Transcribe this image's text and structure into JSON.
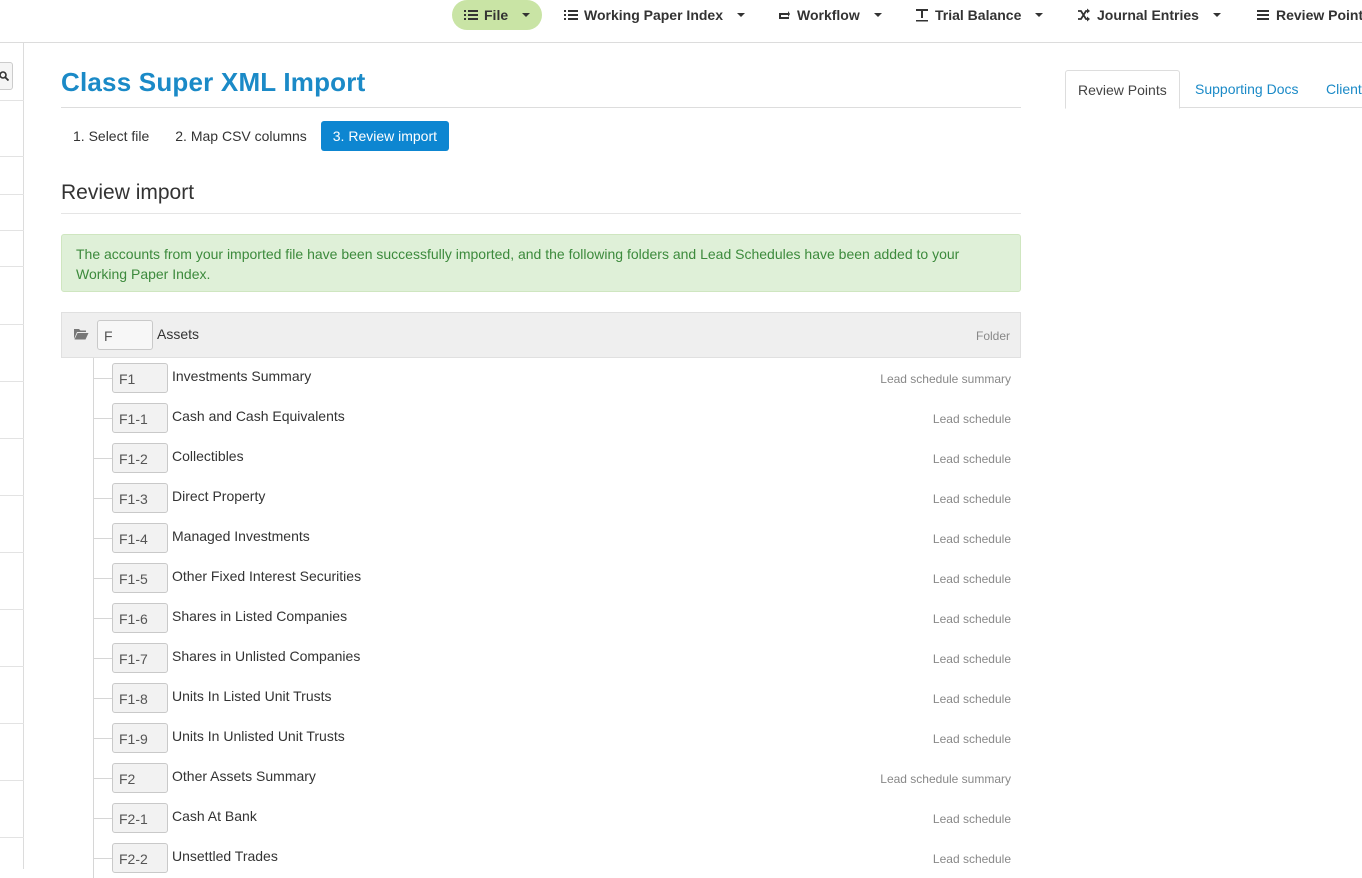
{
  "nav": {
    "items": [
      {
        "label": "File",
        "icon": "list-icon",
        "active": true
      },
      {
        "label": "Working Paper Index",
        "icon": "list-icon",
        "active": false
      },
      {
        "label": "Workflow",
        "icon": "loop-icon",
        "active": false
      },
      {
        "label": "Trial Balance",
        "icon": "text-format-icon",
        "active": false
      },
      {
        "label": "Journal Entries",
        "icon": "shuffle-icon",
        "active": false
      },
      {
        "label": "Review Point",
        "icon": "list-icon",
        "active": false
      }
    ]
  },
  "page": {
    "title": "Class Super XML Import",
    "steps": [
      {
        "label": "1. Select file",
        "active": false
      },
      {
        "label": "2. Map CSV columns",
        "active": false
      },
      {
        "label": "3. Review import",
        "active": true
      }
    ],
    "section_title": "Review import",
    "alert": "The accounts from your imported file have been successfully imported, and the following folders and Lead Schedules have been added to your Working Paper Index."
  },
  "folder": {
    "code": "F",
    "name": "Assets",
    "type": "Folder"
  },
  "rows": [
    {
      "code": "F1",
      "name": "Investments Summary",
      "type": "Lead schedule summary"
    },
    {
      "code": "F1-1",
      "name": "Cash and Cash Equivalents",
      "type": "Lead schedule"
    },
    {
      "code": "F1-2",
      "name": "Collectibles",
      "type": "Lead schedule"
    },
    {
      "code": "F1-3",
      "name": "Direct Property",
      "type": "Lead schedule"
    },
    {
      "code": "F1-4",
      "name": "Managed Investments",
      "type": "Lead schedule"
    },
    {
      "code": "F1-5",
      "name": "Other Fixed Interest Securities",
      "type": "Lead schedule"
    },
    {
      "code": "F1-6",
      "name": "Shares in Listed Companies",
      "type": "Lead schedule"
    },
    {
      "code": "F1-7",
      "name": "Shares in Unlisted Companies",
      "type": "Lead schedule"
    },
    {
      "code": "F1-8",
      "name": "Units In Listed Unit Trusts",
      "type": "Lead schedule"
    },
    {
      "code": "F1-9",
      "name": "Units In Unlisted Unit Trusts",
      "type": "Lead schedule"
    },
    {
      "code": "F2",
      "name": "Other Assets Summary",
      "type": "Lead schedule summary"
    },
    {
      "code": "F2-1",
      "name": "Cash At Bank",
      "type": "Lead schedule"
    },
    {
      "code": "F2-2",
      "name": "Unsettled Trades",
      "type": "Lead schedule"
    }
  ],
  "right_tabs": [
    {
      "label": "Review Points",
      "active": true
    },
    {
      "label": "Supporting Docs",
      "active": false
    },
    {
      "label": "Client",
      "active": false
    }
  ],
  "colors": {
    "accent": "#1b8ac7",
    "step_active": "#0d86d1",
    "nav_active": "#c9e4a5",
    "alert_bg": "#dff0d8",
    "alert_text": "#3c8a3c"
  }
}
